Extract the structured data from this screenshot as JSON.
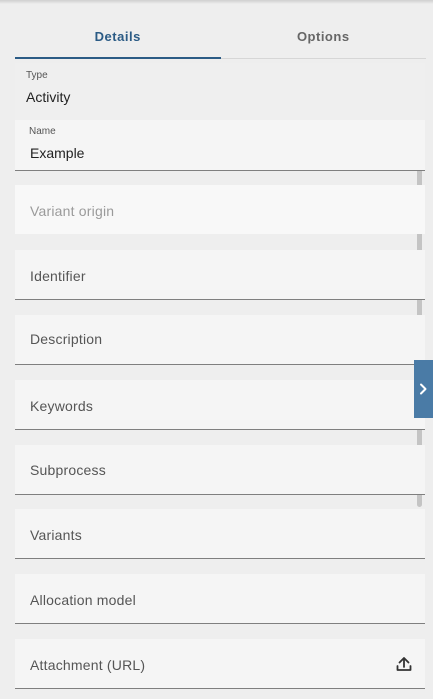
{
  "tabs": [
    {
      "label": "Details",
      "active": true
    },
    {
      "label": "Options",
      "active": false
    }
  ],
  "fields": {
    "type": {
      "label": "Type",
      "value": "Activity"
    },
    "name": {
      "label": "Name",
      "value": "Example"
    },
    "variant_origin": {
      "placeholder": "Variant origin"
    },
    "identifier": {
      "placeholder": "Identifier"
    },
    "description": {
      "placeholder": "Description"
    },
    "keywords": {
      "placeholder": "Keywords"
    },
    "subprocess": {
      "placeholder": "Subprocess"
    },
    "variants": {
      "placeholder": "Variants"
    },
    "allocation_model": {
      "placeholder": "Allocation model"
    },
    "attachment_url": {
      "placeholder": "Attachment (URL)"
    }
  },
  "icons": {
    "expand": "chevron-right-icon",
    "upload": "upload-icon"
  },
  "colors": {
    "accent": "#2b5b85",
    "expand_tab": "#4a7ba6"
  }
}
